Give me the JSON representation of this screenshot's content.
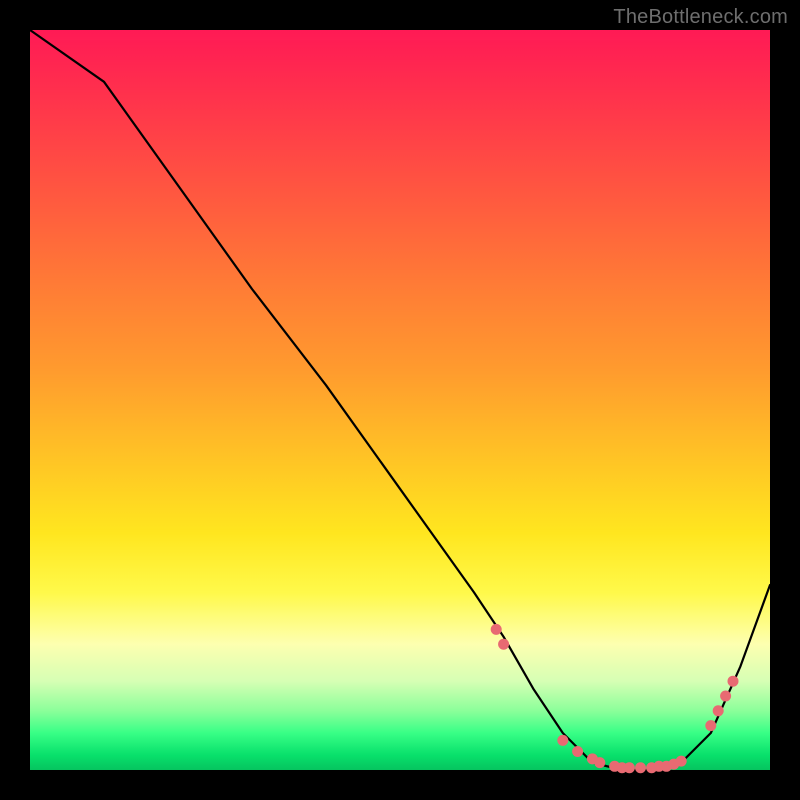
{
  "watermark": "TheBottleneck.com",
  "colors": {
    "curve_stroke": "#000000",
    "dot_fill": "#e86a72",
    "frame_bg": "#000000"
  },
  "chart_data": {
    "type": "line",
    "title": "",
    "xlabel": "",
    "ylabel": "",
    "xlim": [
      0,
      100
    ],
    "ylim": [
      0,
      100
    ],
    "grid": false,
    "legend": null,
    "series": [
      {
        "name": "bottleneck-curve",
        "x": [
          0,
          10,
          20,
          30,
          40,
          50,
          60,
          64,
          68,
          72,
          76,
          80,
          84,
          88,
          92,
          96,
          100
        ],
        "y": [
          100,
          93,
          79,
          65,
          52,
          38,
          24,
          18,
          11,
          5,
          1,
          0,
          0,
          1,
          5,
          14,
          25
        ]
      }
    ],
    "markers": [
      {
        "x": 63,
        "y": 19
      },
      {
        "x": 64,
        "y": 17
      },
      {
        "x": 72,
        "y": 4
      },
      {
        "x": 74,
        "y": 2.5
      },
      {
        "x": 76,
        "y": 1.5
      },
      {
        "x": 77,
        "y": 1
      },
      {
        "x": 79,
        "y": 0.5
      },
      {
        "x": 80,
        "y": 0.3
      },
      {
        "x": 81,
        "y": 0.3
      },
      {
        "x": 82.5,
        "y": 0.3
      },
      {
        "x": 84,
        "y": 0.3
      },
      {
        "x": 85,
        "y": 0.5
      },
      {
        "x": 86,
        "y": 0.5
      },
      {
        "x": 87,
        "y": 0.8
      },
      {
        "x": 88,
        "y": 1.2
      },
      {
        "x": 92,
        "y": 6
      },
      {
        "x": 93,
        "y": 8
      },
      {
        "x": 94,
        "y": 10
      },
      {
        "x": 95,
        "y": 12
      }
    ]
  }
}
